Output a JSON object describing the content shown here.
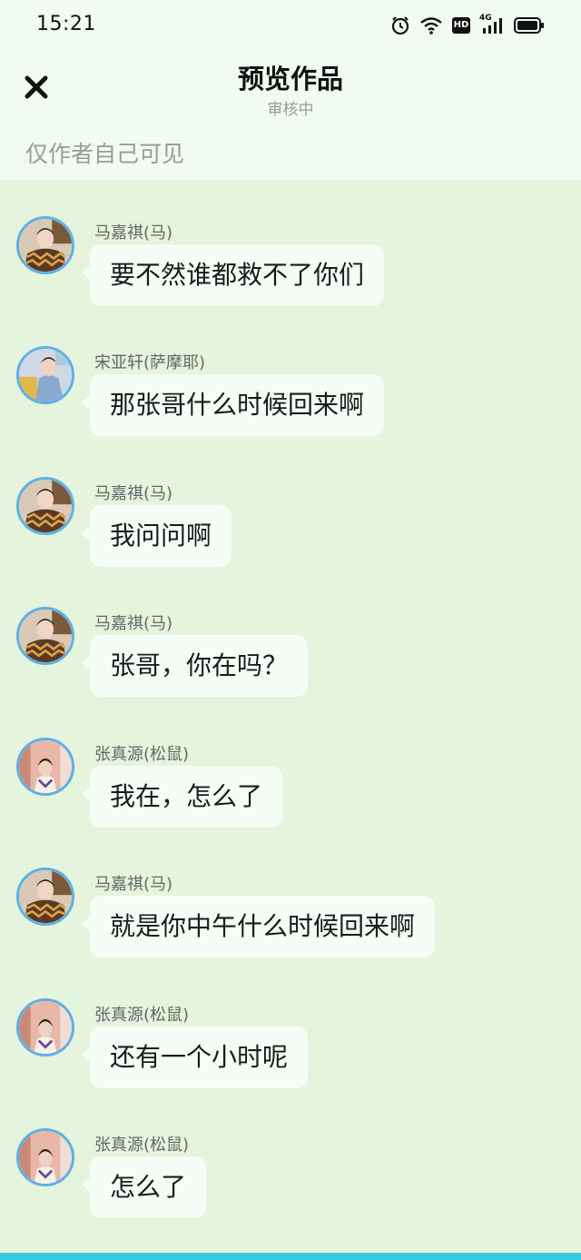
{
  "status_bar": {
    "time": "15:21",
    "icons": [
      "alarm-icon",
      "wifi-icon",
      "hd-icon",
      "4g-signal-icon",
      "battery-icon"
    ],
    "hd_label": "HD",
    "network_label": "4G"
  },
  "header": {
    "title": "预览作品",
    "subtitle": "审核中",
    "close_icon": "close-icon",
    "visibility_note": "仅作者自己可见"
  },
  "colors": {
    "header_bg": "#f1fbf1",
    "chat_bg": "#e4f4dd",
    "bubble_bg": "#f5fdf6",
    "avatar_ring": "#5eb0e5",
    "bottom_bar": "#39c9de"
  },
  "messages": [
    {
      "sender": "马嘉祺(马)",
      "text": "要不然谁都救不了你们",
      "avatar": "avatar-majiaqi"
    },
    {
      "sender": "宋亚轩(萨摩耶)",
      "text": "那张哥什么时候回来啊",
      "avatar": "avatar-songyaxuan"
    },
    {
      "sender": "马嘉祺(马)",
      "text": "我问问啊",
      "avatar": "avatar-majiaqi"
    },
    {
      "sender": "马嘉祺(马)",
      "text": "张哥，你在吗？",
      "avatar": "avatar-majiaqi"
    },
    {
      "sender": "张真源(松鼠)",
      "text": "我在，怎么了",
      "avatar": "avatar-zhangzhenyuan"
    },
    {
      "sender": "马嘉祺(马)",
      "text": "就是你中午什么时候回来啊",
      "avatar": "avatar-majiaqi"
    },
    {
      "sender": "张真源(松鼠)",
      "text": "还有一个小时呢",
      "avatar": "avatar-zhangzhenyuan"
    },
    {
      "sender": "张真源(松鼠)",
      "text": "怎么了",
      "avatar": "avatar-zhangzhenyuan"
    }
  ]
}
